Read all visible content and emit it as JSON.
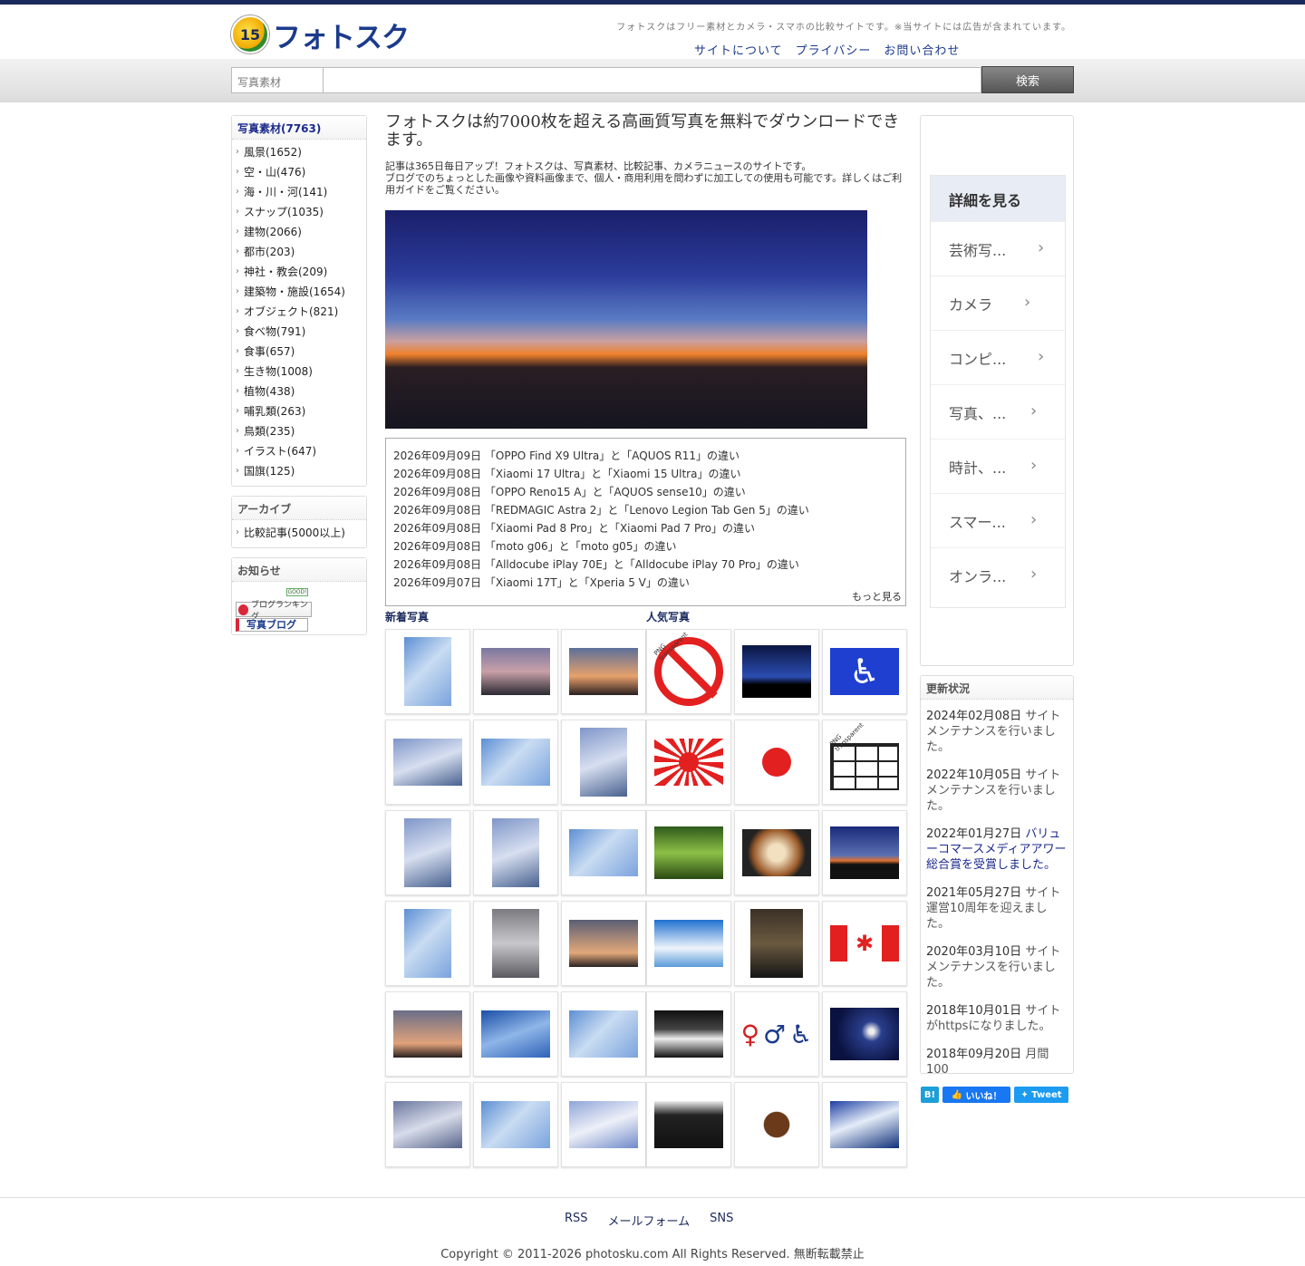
{
  "header": {
    "logo_badge": "15",
    "logo_text": "フォトスク",
    "note": "フォトスクはフリー素材とカメラ・スマホの比較サイトです。※当サイトには広告が含まれています。",
    "nav": [
      "サイトについて",
      "プライバシー",
      "お問い合わせ"
    ]
  },
  "search": {
    "category": "写真素材",
    "button": "検索"
  },
  "sidebar": {
    "categories_title": "写真素材(7763)",
    "categories": [
      "風景(1652)",
      "空・山(476)",
      "海・川・河(141)",
      "スナップ(1035)",
      "建物(2066)",
      "都市(203)",
      "神社・教会(209)",
      "建築物・施設(1654)",
      "オブジェクト(821)",
      "食べ物(791)",
      "食事(657)",
      "生き物(1008)",
      "植物(438)",
      "哺乳類(263)",
      "鳥類(235)",
      "イラスト(647)",
      "国旗(125)"
    ],
    "archive_title": "アーカイブ",
    "archive_items": [
      "比較記事(5000以上)"
    ],
    "notice_title": "お知らせ",
    "banner_good": "GOOD!",
    "banner_ranking": "ブログランキング",
    "banner_blog": "写真ブログ"
  },
  "main": {
    "title": "フォトスクは約7000枚を超える高画質写真を無料でダウンロードできます。",
    "desc1": "記事は365日毎日アップ！フォトスクは、写真素材、比較記事、カメラニュースのサイトです。",
    "desc2": "ブログでのちょっとした画像や資料画像まで、個人・商用利用を問わずに加工しての使用も可能です。詳しくはご利用ガイドをご覧ください。",
    "news": [
      "2026年09月09日 「OPPO Find X9 Ultra」と「AQUOS R11」の違い",
      "2026年09月08日 「Xiaomi 17 Ultra」と「Xiaomi 15 Ultra」の違い",
      "2026年09月08日 「OPPO Reno15 A」と「AQUOS sense10」の違い",
      "2026年09月08日 「REDMAGIC Astra 2」と「Lenovo Legion Tab Gen 5」の違い",
      "2026年09月08日 「Xiaomi Pad 8 Pro」と「Xiaomi Pad 7 Pro」の違い",
      "2026年09月08日 「moto g06」と「moto g05」の違い",
      "2026年09月08日 「Alldocube iPlay 70E」と「Alldocube iPlay 70 Pro」の違い",
      "2026年09月07日 「Xiaomi 17T」と「Xperia 5 V」の違い"
    ],
    "news_more": "もっと見る",
    "new_photos_label": "新着写真",
    "popular_photos_label": "人気写真",
    "png_tag": "PNG transparent"
  },
  "ad": {
    "head": "詳細を見る",
    "items": [
      "芸術写...",
      "カメラ",
      "コンピ...",
      "写真、...",
      "時計、...",
      "スマー...",
      "オンラ..."
    ]
  },
  "updates": {
    "title": "更新状況",
    "entries": [
      {
        "date": "2024年02月08日",
        "text": "サイトメンテナンスを行いました。"
      },
      {
        "date": "2022年10月05日",
        "text": "サイトメンテナンスを行いました。"
      },
      {
        "date": "2022年01月27日",
        "text": "バリューコマースメディアアワー総合賞を受賞しました。"
      },
      {
        "date": "2021年05月27日",
        "text": "サイト運営10周年を迎えました。"
      },
      {
        "date": "2020年03月10日",
        "text": "サイトメンテナンスを行いました。"
      },
      {
        "date": "2018年10月01日",
        "text": "サイトがhttpsになりました。"
      },
      {
        "date": "2018年09月20日",
        "text": "月間100"
      }
    ]
  },
  "social": {
    "hatena": "B!",
    "like": "いいね！",
    "tweet": "Tweet"
  },
  "footer": {
    "links": [
      "RSS",
      "メールフォーム",
      "SNS"
    ],
    "copyright": "Copyright © 2011-2026 photosku.com All Rights Reserved. 無断転載禁止"
  },
  "colors": {
    "brand": "#1b2a5e",
    "link": "#1b3a8c",
    "search_button": "#666666"
  }
}
